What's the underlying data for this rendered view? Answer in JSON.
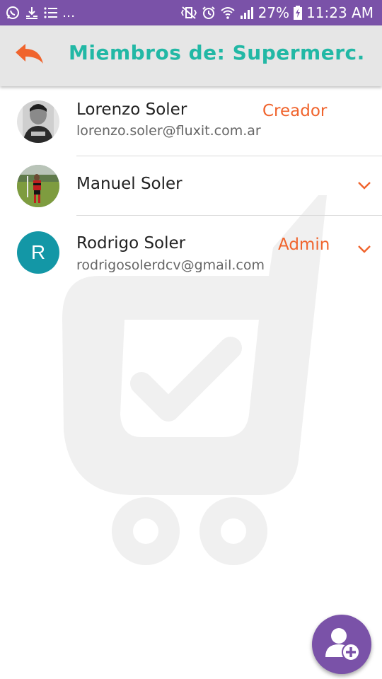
{
  "status_bar": {
    "left_icons": [
      "whatsapp-icon",
      "download-icon",
      "list-icon"
    ],
    "overflow": "...",
    "right_icons": [
      "vibrate-icon",
      "alarm-icon",
      "wifi-icon",
      "signal-icon"
    ],
    "battery": "27%",
    "time": "11:23 AM"
  },
  "app_bar": {
    "back_icon": "back-arrow-icon",
    "title": "Miembros de: Supermerc..."
  },
  "members": [
    {
      "name": "Lorenzo Soler",
      "email": "lorenzo.soler@fluxit.com.ar",
      "role": "Creador",
      "avatar": "photo"
    },
    {
      "name": "Manuel Soler",
      "email": "",
      "role": "",
      "avatar": "photo"
    },
    {
      "name": "Rodrigo Soler",
      "email": "rodrigosolerdcv@gmail.com",
      "role": "Admin",
      "avatar_letter": "R"
    }
  ],
  "fab": {
    "icon": "add-member-icon"
  },
  "colors": {
    "primary": "#7a52a8",
    "title": "#22b8a5",
    "accent": "#f0642d",
    "avatar_r": "#1397a6",
    "appbar": "#e6e6e6"
  }
}
